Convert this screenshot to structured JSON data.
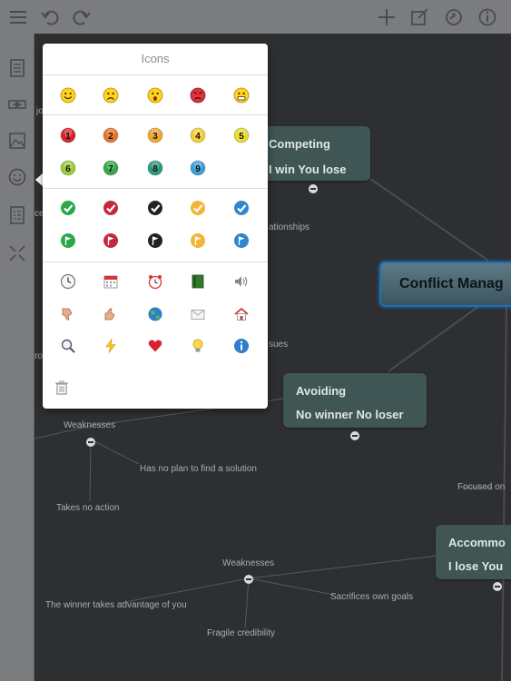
{
  "popover": {
    "title": "Icons"
  },
  "nodes": {
    "competing": {
      "line1": "Competing",
      "line2": "I win You lose"
    },
    "avoiding": {
      "line1": "Avoiding",
      "line2": "No winner No loser"
    },
    "accommodating": {
      "line1": "Accommo",
      "line2": "I lose You"
    },
    "root": {
      "label": "Conflict Manag"
    }
  },
  "labels": {
    "relationships": "ationships",
    "issues": "sues",
    "weaknesses1": "Weaknesses",
    "no_plan": "Has no plan to find a solution",
    "takes_no_action": "Takes no action",
    "focused": "Focused on",
    "weaknesses2": "Weaknesses",
    "winner_advantage": "The winner takes advantage of you",
    "sacrifices": "Sacrifices own goals",
    "fragile": "Fragile credibility",
    "left_jo": "jo",
    "left_ce": "ce",
    "left_ro": "ro"
  },
  "icon_rows": [
    [
      "smiley-happy-icon",
      "smiley-sad-icon",
      "smiley-surprised-icon",
      "smiley-angry-icon",
      "smiley-grin-icon"
    ],
    [
      "priority-1-icon",
      "priority-2-icon",
      "priority-3-icon",
      "priority-4-icon",
      "priority-5-icon"
    ],
    [
      "priority-6-icon",
      "priority-7-icon",
      "priority-8-icon",
      "priority-9-icon"
    ],
    [
      "check-green-icon",
      "check-red-icon",
      "check-black-icon",
      "check-orange-icon",
      "check-blue-icon"
    ],
    [
      "flag-green-icon",
      "flag-red-icon",
      "flag-black-icon",
      "flag-orange-icon",
      "flag-blue-icon"
    ],
    [
      "clock-icon",
      "calendar-icon",
      "alarm-icon",
      "book-icon",
      "speaker-icon"
    ],
    [
      "thumbs-down-icon",
      "thumbs-up-icon",
      "globe-icon",
      "mail-icon",
      "home-icon"
    ],
    [
      "magnifier-icon",
      "lightning-icon",
      "heart-icon",
      "lightbulb-icon",
      "info-icon"
    ]
  ],
  "priority_numbers": [
    "1",
    "2",
    "3",
    "4",
    "5",
    "6",
    "7",
    "8",
    "9"
  ],
  "colors": {
    "toolbar": "#7b7c7e",
    "canvas": "#2e2f31",
    "node": "#3f5655",
    "root_border": "#1e6fb5"
  }
}
